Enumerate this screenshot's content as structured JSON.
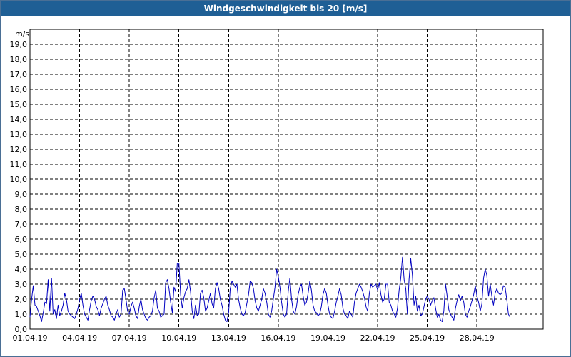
{
  "window": {
    "title": "Windgeschwindigkeit bis 20 [m/s]"
  },
  "chart_data": {
    "type": "line",
    "title": "Windgeschwindigkeit bis 20 [m/s]",
    "ylabel": "m/s",
    "xlabel": "",
    "ylim": [
      0,
      20
    ],
    "xlim_days": [
      0,
      31
    ],
    "y_ticks": [
      "0,0",
      "1,0",
      "2,0",
      "3,0",
      "4,0",
      "5,0",
      "6,0",
      "7,0",
      "8,0",
      "9,0",
      "10,0",
      "11,0",
      "12,0",
      "13,0",
      "14,0",
      "15,0",
      "16,0",
      "17,0",
      "18,0",
      "19,0"
    ],
    "x_ticks": [
      {
        "label": "01.04.19",
        "day": 0
      },
      {
        "label": "04.04.19",
        "day": 3
      },
      {
        "label": "07.04.19",
        "day": 6
      },
      {
        "label": "10.04.19",
        "day": 9
      },
      {
        "label": "13.04.19",
        "day": 12
      },
      {
        "label": "16.04.19",
        "day": 15
      },
      {
        "label": "19.04.19",
        "day": 18
      },
      {
        "label": "22.04.19",
        "day": 21
      },
      {
        "label": "25.04.19",
        "day": 24
      },
      {
        "label": "28.04.19",
        "day": 27
      }
    ],
    "grid": true,
    "series": [
      {
        "line_color": "#0000c0",
        "x_days": [
          0.0,
          0.1,
          0.2,
          0.3,
          0.4,
          0.5,
          0.6,
          0.7,
          0.8,
          0.9,
          1.0,
          1.1,
          1.2,
          1.3,
          1.4,
          1.5,
          1.6,
          1.7,
          1.8,
          1.9,
          2.0,
          2.1,
          2.2,
          2.3,
          2.4,
          2.5,
          2.6,
          2.7,
          2.8,
          2.9,
          3.0,
          3.1,
          3.2,
          3.3,
          3.4,
          3.5,
          3.6,
          3.7,
          3.8,
          3.9,
          4.0,
          4.1,
          4.2,
          4.3,
          4.4,
          4.5,
          4.6,
          4.7,
          4.8,
          4.9,
          5.0,
          5.1,
          5.2,
          5.3,
          5.4,
          5.5,
          5.6,
          5.7,
          5.8,
          5.9,
          6.0,
          6.1,
          6.2,
          6.3,
          6.4,
          6.5,
          6.6,
          6.7,
          6.8,
          6.9,
          7.0,
          7.1,
          7.2,
          7.3,
          7.4,
          7.5,
          7.6,
          7.7,
          7.8,
          7.9,
          8.0,
          8.1,
          8.2,
          8.3,
          8.4,
          8.5,
          8.6,
          8.7,
          8.8,
          8.9,
          9.0,
          9.1,
          9.2,
          9.3,
          9.4,
          9.5,
          9.6,
          9.7,
          9.8,
          9.9,
          10.0,
          10.1,
          10.2,
          10.3,
          10.4,
          10.5,
          10.6,
          10.7,
          10.8,
          10.9,
          11.0,
          11.1,
          11.2,
          11.3,
          11.4,
          11.5,
          11.6,
          11.7,
          11.8,
          11.9,
          12.0,
          12.1,
          12.2,
          12.3,
          12.4,
          12.5,
          12.6,
          12.7,
          12.8,
          12.9,
          13.0,
          13.1,
          13.2,
          13.3,
          13.4,
          13.5,
          13.6,
          13.7,
          13.8,
          13.9,
          14.0,
          14.1,
          14.2,
          14.3,
          14.4,
          14.5,
          14.6,
          14.7,
          14.8,
          14.9,
          15.0,
          15.1,
          15.2,
          15.3,
          15.4,
          15.5,
          15.6,
          15.7,
          15.8,
          15.9,
          16.0,
          16.1,
          16.2,
          16.3,
          16.4,
          16.5,
          16.6,
          16.7,
          16.8,
          16.9,
          17.0,
          17.1,
          17.2,
          17.3,
          17.4,
          17.5,
          17.6,
          17.7,
          17.8,
          17.9,
          18.0,
          18.1,
          18.2,
          18.3,
          18.4,
          18.5,
          18.6,
          18.7,
          18.8,
          18.9,
          19.0,
          19.1,
          19.2,
          19.3,
          19.4,
          19.5,
          19.6,
          19.7,
          19.8,
          19.9,
          20.0,
          20.1,
          20.2,
          20.3,
          20.4,
          20.5,
          20.6,
          20.7,
          20.8,
          20.9,
          21.0,
          21.1,
          21.2,
          21.3,
          21.4,
          21.5,
          21.6,
          21.7,
          21.8,
          21.9,
          22.0,
          22.1,
          22.2,
          22.3,
          22.4,
          22.5,
          22.6,
          22.7,
          22.8,
          22.9,
          23.0,
          23.1,
          23.2,
          23.3,
          23.4,
          23.5,
          23.6,
          23.7,
          23.8,
          23.9,
          24.0,
          24.1,
          24.2,
          24.3,
          24.4,
          24.5,
          24.6,
          24.7,
          24.8,
          24.9,
          25.0,
          25.1,
          25.2,
          25.3,
          25.4,
          25.5,
          25.6,
          25.7,
          25.8,
          25.9,
          26.0,
          26.1,
          26.2,
          26.3,
          26.4,
          26.5,
          26.6,
          26.7,
          26.8,
          26.9,
          27.0,
          27.1,
          27.2,
          27.3,
          27.4,
          27.5,
          27.6,
          27.7,
          27.8,
          27.9,
          28.0,
          28.1,
          28.2,
          28.3,
          28.4,
          28.5,
          28.6,
          28.7,
          28.8,
          28.9,
          29.0,
          29.1,
          29.2,
          29.3,
          29.4,
          29.5,
          29.6,
          29.7,
          29.8,
          29.9,
          30.0,
          30.1,
          30.2,
          30.3,
          30.4,
          30.5,
          30.6,
          30.7,
          30.8,
          30.9,
          31.0
        ],
        "values": [
          0.8,
          2.0,
          2.9,
          1.6,
          1.5,
          1.2,
          0.9,
          0.5,
          1.1,
          1.8,
          1.7,
          3.3,
          1.2,
          3.4,
          1.0,
          1.3,
          0.7,
          1.6,
          0.9,
          1.2,
          1.6,
          2.4,
          2.0,
          1.2,
          1.0,
          0.9,
          0.8,
          0.7,
          1.0,
          1.4,
          2.0,
          2.4,
          1.6,
          1.0,
          0.8,
          0.6,
          1.3,
          1.9,
          2.2,
          2.0,
          1.5,
          1.3,
          0.9,
          1.4,
          1.7,
          2.0,
          2.2,
          1.6,
          1.3,
          0.9,
          0.8,
          0.6,
          1.0,
          1.3,
          0.8,
          1.0,
          2.6,
          2.7,
          2.0,
          1.2,
          1.0,
          1.5,
          1.8,
          1.4,
          0.9,
          0.7,
          1.5,
          2.0,
          1.3,
          1.0,
          0.7,
          0.6,
          0.8,
          0.9,
          1.2,
          2.1,
          2.6,
          1.4,
          1.2,
          0.8,
          0.9,
          1.0,
          3.1,
          3.3,
          2.7,
          1.8,
          1.1,
          2.8,
          2.5,
          4.4,
          4.4,
          2.3,
          1.4,
          2.1,
          2.5,
          2.7,
          3.3,
          2.5,
          1.2,
          0.7,
          1.6,
          0.9,
          1.0,
          2.4,
          2.6,
          2.1,
          1.2,
          1.4,
          1.9,
          2.4,
          1.7,
          1.4,
          2.7,
          3.1,
          2.7,
          2.0,
          1.6,
          1.0,
          0.6,
          0.5,
          1.1,
          2.7,
          3.2,
          3.0,
          2.8,
          3.0,
          2.0,
          1.4,
          1.0,
          0.9,
          1.1,
          1.7,
          2.3,
          3.2,
          3.1,
          2.7,
          1.9,
          1.4,
          1.2,
          1.6,
          2.0,
          2.7,
          2.4,
          1.8,
          1.0,
          0.8,
          1.2,
          2.0,
          2.8,
          4.0,
          3.5,
          2.8,
          1.8,
          1.0,
          0.8,
          1.0,
          2.5,
          3.4,
          2.0,
          1.2,
          1.0,
          1.5,
          2.3,
          2.8,
          3.0,
          2.2,
          1.6,
          1.8,
          2.4,
          3.2,
          2.6,
          1.6,
          1.2,
          1.1,
          0.9,
          1.0,
          1.5,
          2.3,
          2.7,
          2.4,
          1.6,
          1.0,
          0.8,
          0.7,
          1.2,
          1.8,
          2.2,
          2.7,
          2.3,
          1.4,
          1.0,
          0.9,
          0.7,
          1.2,
          1.0,
          0.8,
          1.8,
          2.4,
          2.7,
          3.0,
          2.8,
          2.5,
          2.1,
          1.5,
          1.2,
          2.4,
          3.0,
          2.8,
          2.9,
          3.0,
          2.6,
          3.1,
          2.3,
          1.8,
          2.0,
          3.0,
          3.0,
          1.8,
          1.6,
          1.2,
          1.0,
          0.8,
          1.4,
          2.6,
          3.4,
          4.8,
          3.3,
          2.7,
          1.0,
          3.3,
          4.7,
          3.6,
          1.6,
          2.2,
          1.2,
          1.6,
          0.9,
          1.0,
          1.5,
          2.0,
          2.2,
          2.0,
          1.6,
          1.9,
          2.1,
          1.4,
          0.8,
          1.0,
          0.6,
          0.5,
          1.2,
          3.0,
          2.2,
          1.3,
          1.0,
          0.8,
          0.6,
          1.4,
          1.9,
          2.3,
          1.9,
          2.2,
          1.8,
          1.0,
          0.8,
          1.2,
          1.5,
          1.9,
          2.3,
          2.9,
          2.2,
          1.8,
          1.2,
          1.7,
          3.4,
          4.0,
          3.6,
          2.2,
          3.0,
          2.2,
          1.6,
          2.4,
          2.7,
          2.4,
          2.3,
          2.4,
          2.9,
          2.8,
          2.0,
          1.0,
          0.8
        ]
      }
    ]
  }
}
